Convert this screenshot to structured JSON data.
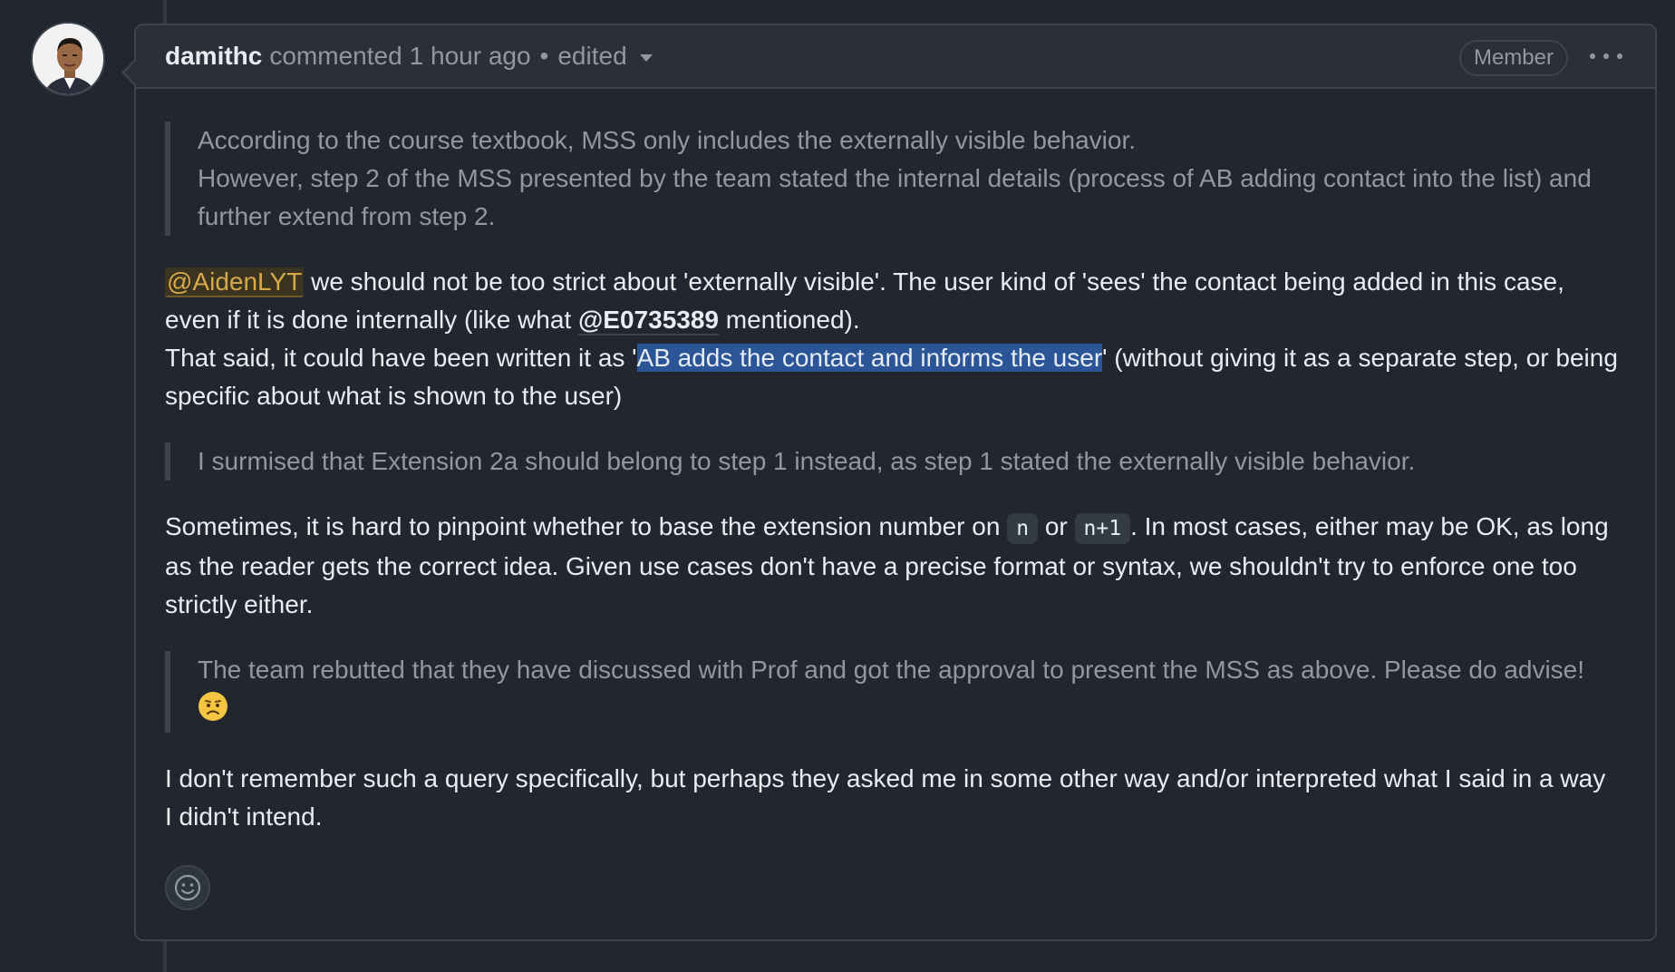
{
  "comment": {
    "author": "damithc",
    "action": "commented",
    "time": "1 hour ago",
    "separator": "•",
    "edited": "edited",
    "role_badge": "Member",
    "more_icon": "kebab-horizontal-icon",
    "reaction_icon": "smiley-icon"
  },
  "body": {
    "quote1_line1": "According to the course textbook, MSS only includes the externally visible behavior.",
    "quote1_line2": "However, step 2 of the MSS presented by the team stated the internal details (process of AB adding contact into the list) and further extend from step 2.",
    "p1_mention": "@AidenLYT",
    "p1_text1": " we should not be too strict about 'externally visible'. The user kind of 'sees' the contact being added in this case, even if it is done internally (like what ",
    "p1_mention2": "@E0735389",
    "p1_text2": " mentioned).",
    "p1_text3": "That said, it could have been written it as '",
    "p1_selected": "AB adds the contact and informs the user",
    "p1_text4": "' (without giving it as a separate step, or being specific about what is shown to the user)",
    "quote2": "I surmised that Extension 2a should belong to step 1 instead, as step 1 stated the externally visible behavior.",
    "p2_text1": "Sometimes, it is hard to pinpoint whether to base the extension number on ",
    "p2_code1": "n",
    "p2_text2": " or ",
    "p2_code2": "n+1",
    "p2_text3": ". In most cases, either may be OK, as long as the reader gets the correct idea. Given use cases don't have a precise format or syntax, we shouldn't try to enforce one too strictly either.",
    "quote3": "The team rebutted that they have discussed with Prof and got the approval to present the MSS as above. Please do advise!",
    "quote3_emoji": "worried-face-emoji",
    "p3": "I don't remember such a query specifically, but perhaps they asked me in some other way and/or interpreted what I said in a way I didn't intend."
  },
  "colors": {
    "background": "#22262e",
    "header": "#2b3037",
    "border": "#3d444d",
    "muted_text": "#9198a1",
    "mention_highlight": "#d7a94a",
    "selection": "#2c5598"
  }
}
